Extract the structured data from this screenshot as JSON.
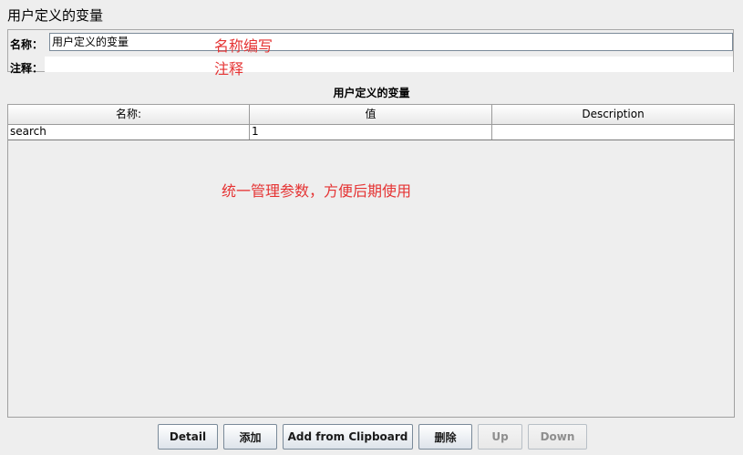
{
  "page": {
    "title": "用户定义的变量"
  },
  "form": {
    "name_label": "名称：",
    "name_value": "用户定义的变量",
    "comment_label": "注释：",
    "comment_value": ""
  },
  "annotations": {
    "name_note": "名称编写",
    "comment_note": "注释",
    "table_note": "统一管理参数，方便后期使用"
  },
  "table": {
    "title": "用户定义的变量",
    "columns": [
      "名称:",
      "值",
      "Description"
    ],
    "rows": [
      [
        "search",
        "1",
        ""
      ]
    ]
  },
  "buttons": {
    "detail": "Detail",
    "add": "添加",
    "add_from_clipboard": "Add from Clipboard",
    "delete": "删除",
    "up": "Up",
    "down": "Down"
  },
  "colors": {
    "annotation": "#e53333",
    "background": "#eeeeee"
  }
}
